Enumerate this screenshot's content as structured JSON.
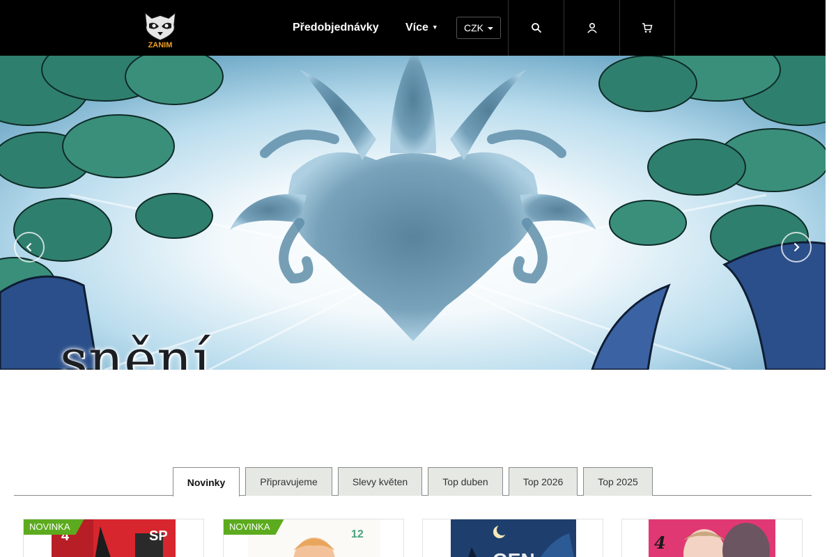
{
  "header": {
    "logo_icon": "raccoon-logo-icon",
    "logo_text": "ZANIM",
    "nav": {
      "preorders_label": "Předobjednávky",
      "more_label": "Více"
    },
    "currency": "CZK",
    "icons": [
      "search-icon",
      "user-icon",
      "cart-icon"
    ]
  },
  "hero": {
    "title": "snění",
    "prev_icon": "chevron-left-icon",
    "next_icon": "chevron-right-icon"
  },
  "tabs": [
    {
      "label": "Novinky",
      "active": true
    },
    {
      "label": "Připravujeme",
      "active": false
    },
    {
      "label": "Slevy květen",
      "active": false
    },
    {
      "label": "Top duben",
      "active": false
    },
    {
      "label": "Top 2026",
      "active": false
    },
    {
      "label": "Top 2025",
      "active": false
    }
  ],
  "products": [
    {
      "badge": "NOVINKA",
      "cover_number": "4"
    },
    {
      "badge": "NOVINKA",
      "cover_number": "12"
    },
    {
      "badge": "",
      "cover_number": ""
    },
    {
      "badge": "",
      "cover_number": "4"
    }
  ],
  "colors": {
    "header_bg": "#000000",
    "badge_green": "#5cab1e",
    "tab_inactive_bg": "#e6e8e4"
  }
}
